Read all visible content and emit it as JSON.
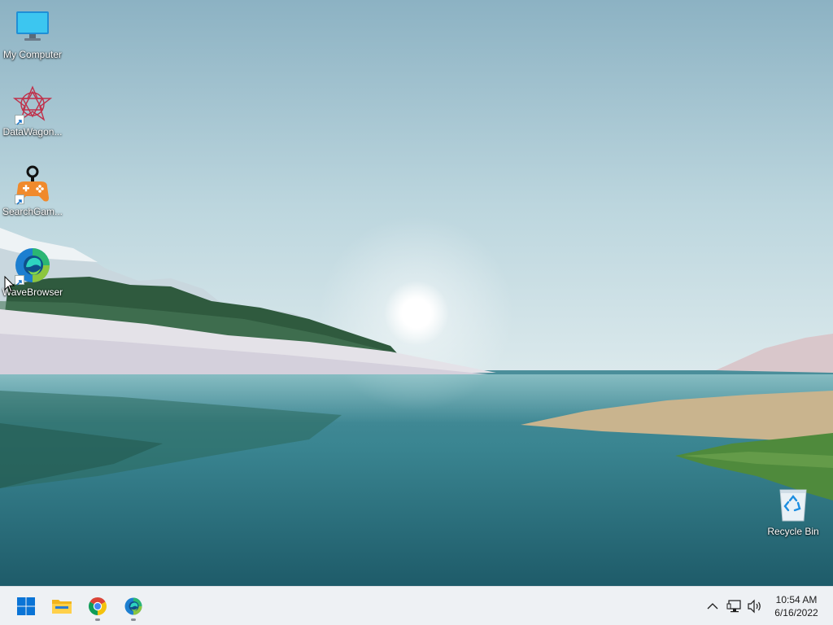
{
  "desktop": {
    "icons": [
      {
        "label": "My Computer",
        "icon": "monitor-icon"
      },
      {
        "label": "DataWagon...",
        "icon": "datawagon-icon"
      },
      {
        "label": "SearchGam...",
        "icon": "gamepad-icon"
      },
      {
        "label": "WaveBrowser",
        "icon": "wavebrowser-icon"
      },
      {
        "label": "Recycle Bin",
        "icon": "recycle-bin-icon"
      }
    ]
  },
  "taskbar": {
    "apps": [
      {
        "name": "start",
        "icon": "windows-start-icon",
        "running": false
      },
      {
        "name": "file-explorer",
        "icon": "folder-icon",
        "running": false
      },
      {
        "name": "chrome",
        "icon": "chrome-icon",
        "running": true
      },
      {
        "name": "wavebrowser",
        "icon": "wavebrowser-icon",
        "running": true
      }
    ],
    "tray": {
      "icons": [
        "chevron-up-icon",
        "network-icon",
        "volume-icon"
      ]
    },
    "clock": {
      "time": "10:54 AM",
      "date": "6/16/2022"
    }
  },
  "colors": {
    "taskbar_bg": "#eef1f4",
    "windows_blue": "#0a74d6",
    "label_text": "#ffffff"
  }
}
